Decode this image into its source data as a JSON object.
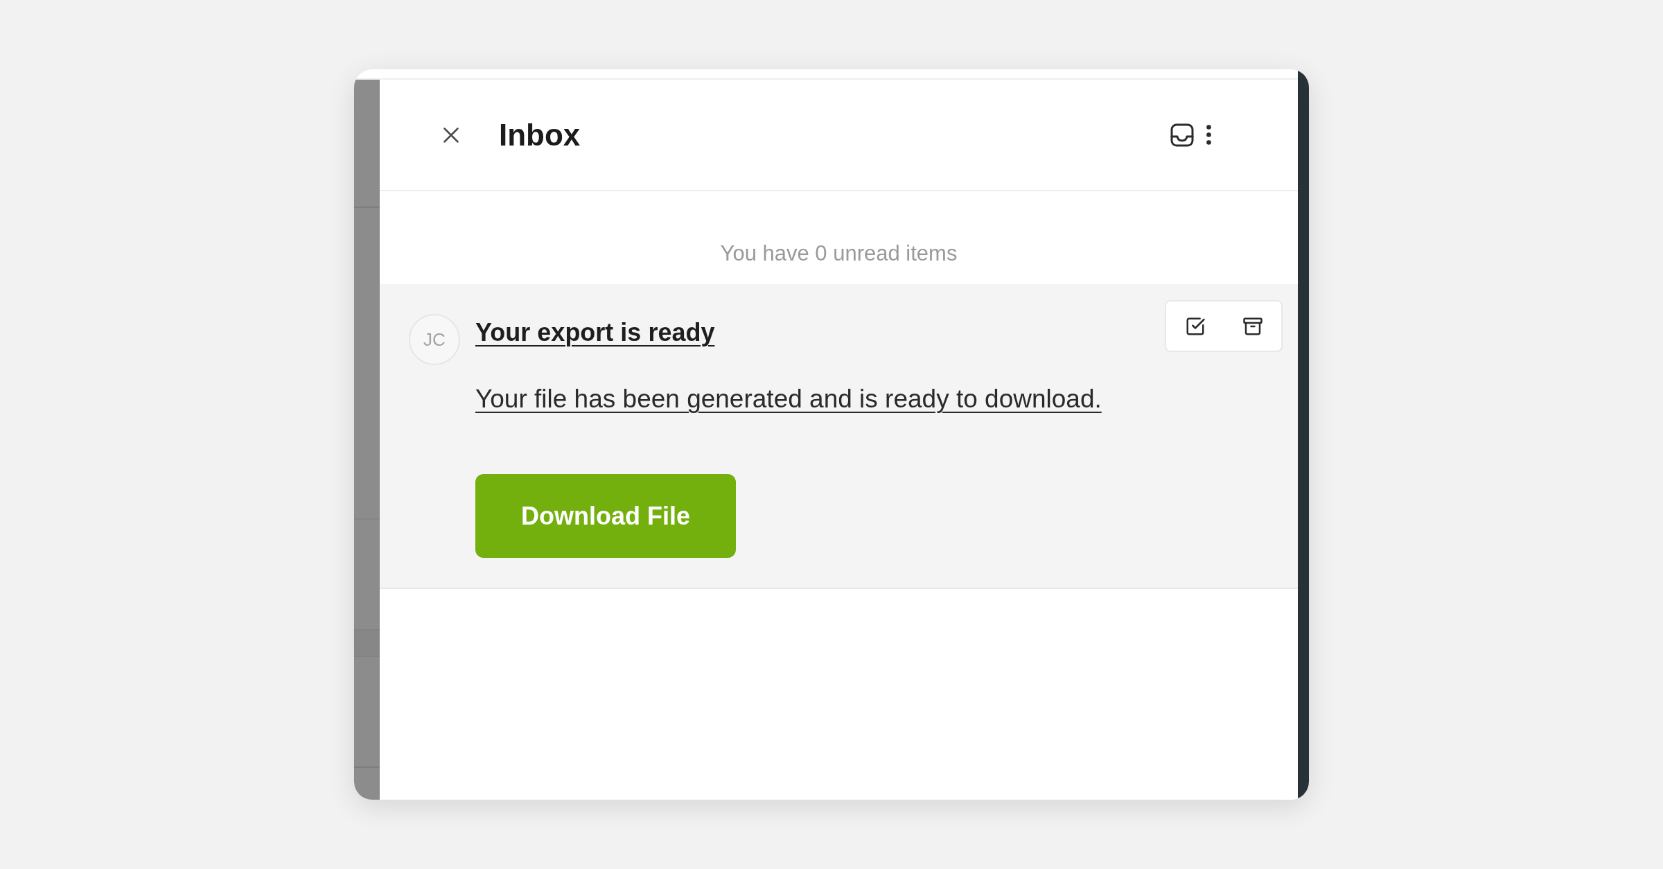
{
  "panel": {
    "title": "Inbox"
  },
  "summary": "You have 0 unread items",
  "notifications": [
    {
      "avatar": "JC",
      "title": "Your export is ready",
      "message": "Your file has been generated and is ready to download.",
      "action": "Download File"
    }
  ]
}
